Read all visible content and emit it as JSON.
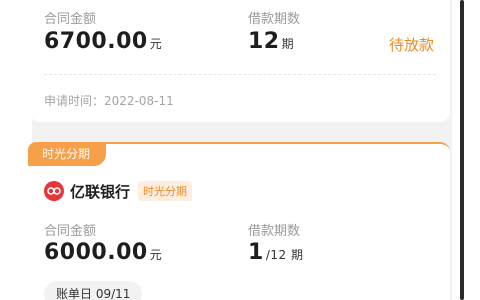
{
  "loan1": {
    "contract_amount_label": "合同金额",
    "contract_amount_value": "6700.00",
    "contract_amount_unit": "元",
    "term_label": "借款期数",
    "term_value": "12",
    "term_unit": "期",
    "status": "待放款",
    "apply_time": "申请时间：2022-08-11"
  },
  "loan2": {
    "product_tag": "时光分期",
    "bank_name": "亿联银行",
    "bank_badge": "时光分期",
    "contract_amount_label": "合同金额",
    "contract_amount_value": "6000.00",
    "contract_amount_unit": "元",
    "term_label": "借款期数",
    "term_value": "1",
    "term_unit": "/12 期",
    "bill_day": "账单日 09/11"
  },
  "colors": {
    "accent": "#f7a04a",
    "status_orange": "#f08a24",
    "bank_red": "#e8353b"
  },
  "icons": {
    "bank_logo": "yilian-bank-logo-icon"
  }
}
